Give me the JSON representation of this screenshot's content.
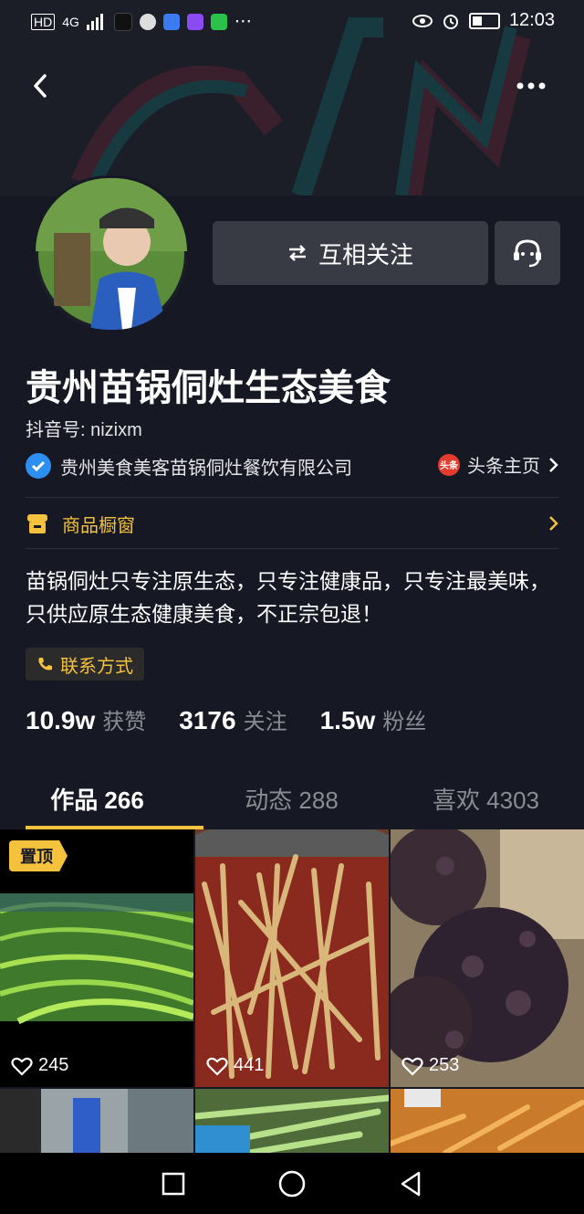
{
  "status_bar": {
    "network": "4G",
    "time": "12:03"
  },
  "profile": {
    "name": "贵州苗锅侗灶生态美食",
    "douyin_id": "抖音号: nizixm",
    "verified_org": "贵州美食美客苗锅侗灶餐饮有限公司",
    "toutiao_label": "头条主页",
    "toutiao_logo_text": "头条",
    "shop_label": "商品橱窗",
    "bio": "苗锅侗灶只专注原生态，只专注健康品，只专注最美味，只供应原生态健康美食，不正宗包退！",
    "contact_label": "联系方式",
    "follow_label": "互相关注"
  },
  "stats": [
    {
      "value": "10.9w",
      "label": "获赞"
    },
    {
      "value": "3176",
      "label": "关注"
    },
    {
      "value": "1.5w",
      "label": "粉丝"
    }
  ],
  "tabs": [
    {
      "label": "作品 266",
      "active": true
    },
    {
      "label": "动态 288",
      "active": false
    },
    {
      "label": "喜欢 4303",
      "active": false
    }
  ],
  "videos": [
    {
      "likes": "245",
      "pinned_label": "置顶",
      "scene": "terraced-fields"
    },
    {
      "likes": "441",
      "pinned_label": "",
      "scene": "pickled-bamboo"
    },
    {
      "likes": "253",
      "pinned_label": "",
      "scene": "dark-fungus"
    },
    {
      "likes": "",
      "pinned_label": "",
      "scene": "jar-on-table"
    },
    {
      "likes": "",
      "pinned_label": "",
      "scene": "green-vegetables"
    },
    {
      "likes": "",
      "pinned_label": "",
      "scene": "orange-pickles"
    }
  ],
  "colors": {
    "background": "#161823",
    "accent": "#f5c23e",
    "button": "#393b44",
    "verified": "#2d8ff0"
  }
}
